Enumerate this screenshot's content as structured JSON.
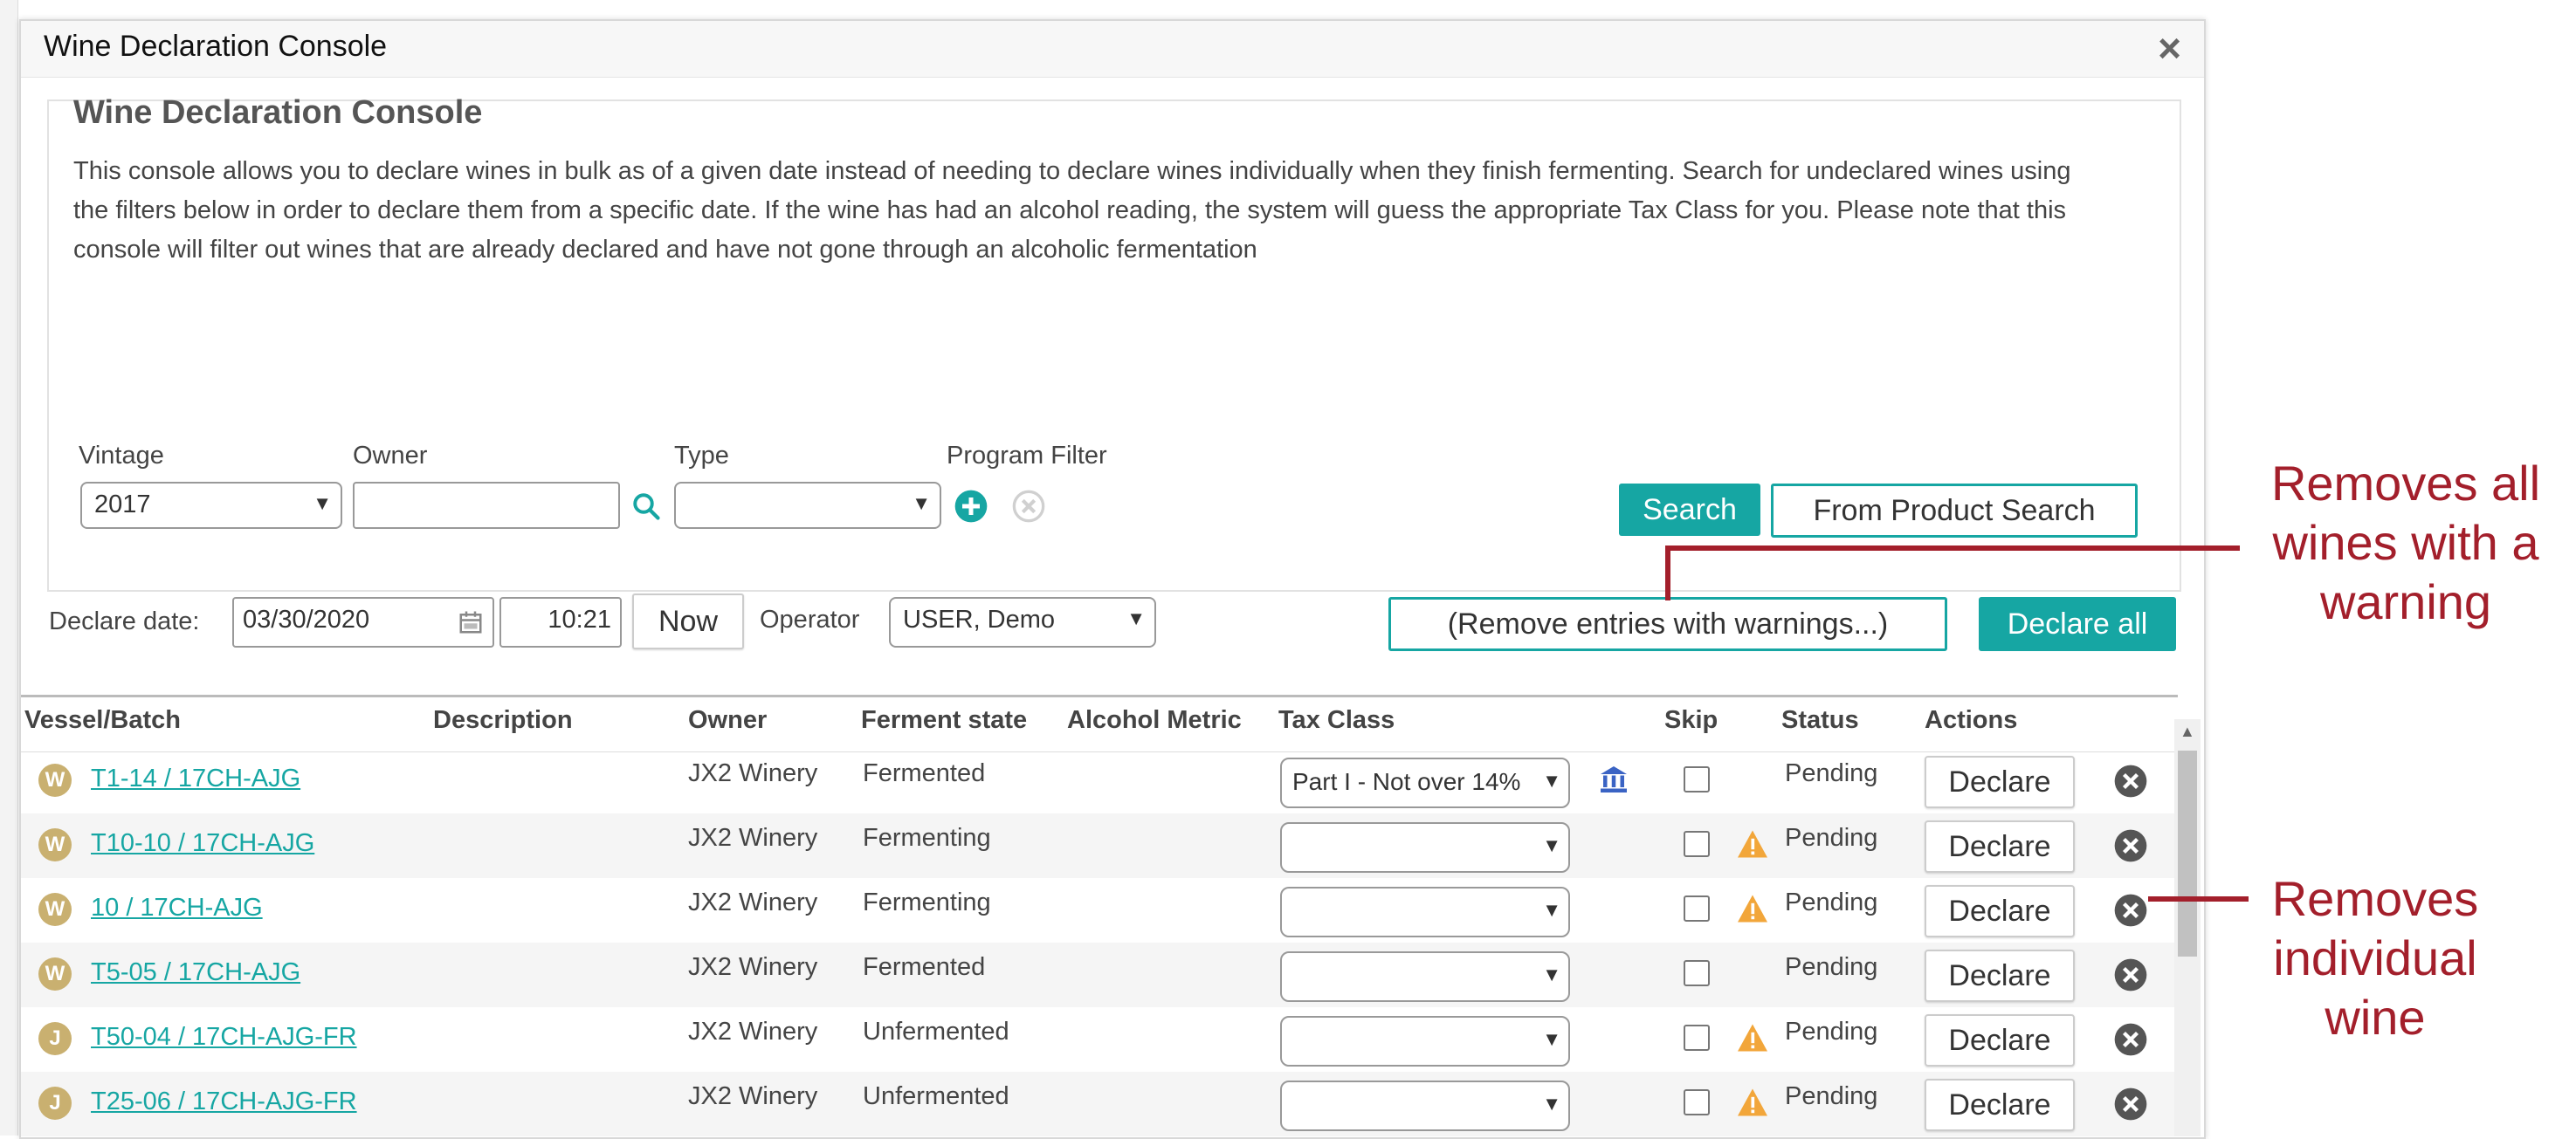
{
  "modal": {
    "title": "Wine Declaration Console",
    "close_glyph": "×"
  },
  "panel": {
    "title": "Wine Declaration Console",
    "description": "This console allows you to declare wines in bulk as of a given date instead of needing to declare wines individually when they finish fermenting. Search for undeclared wines using the filters below in order to declare them from a specific date. If the wine has had an alcohol reading, the system will guess the appropriate Tax Class for you. Please note that this console will filter out wines that are already declared and have not gone through an alcoholic fermentation"
  },
  "filters": {
    "vintage_label": "Vintage",
    "vintage_value": "2017",
    "owner_label": "Owner",
    "owner_value": "",
    "type_label": "Type",
    "type_value": "",
    "program_label": "Program Filter"
  },
  "buttons": {
    "search": "Search",
    "from_product_search": "From Product Search",
    "now": "Now",
    "remove_warnings": "(Remove entries with warnings...)",
    "declare_all": "Declare all"
  },
  "declare": {
    "date_label": "Declare date:",
    "date_value": "03/30/2020",
    "time_value": "10:21",
    "operator_label": "Operator",
    "operator_value": "USER, Demo"
  },
  "table": {
    "headers": {
      "vessel": "Vessel/Batch",
      "description": "Description",
      "owner": "Owner",
      "ferment": "Ferment state",
      "alcohol": "Alcohol Metric",
      "tax": "Tax Class",
      "skip": "Skip",
      "status": "Status",
      "actions": "Actions"
    },
    "declare_label": "Declare",
    "rows": [
      {
        "badge": "W",
        "vessel": "T1-14 / 17CH-AJG",
        "owner": "JX2 Winery",
        "ferment": "Fermented",
        "tax": "Part I - Not over 14%",
        "status": "Pending",
        "warning": false,
        "bank": true
      },
      {
        "badge": "W",
        "vessel": "T10-10 / 17CH-AJG",
        "owner": "JX2 Winery",
        "ferment": "Fermenting",
        "tax": "",
        "status": "Pending",
        "warning": true,
        "bank": false
      },
      {
        "badge": "W",
        "vessel": "10 / 17CH-AJG",
        "owner": "JX2 Winery",
        "ferment": "Fermenting",
        "tax": "",
        "status": "Pending",
        "warning": true,
        "bank": false
      },
      {
        "badge": "W",
        "vessel": "T5-05 / 17CH-AJG",
        "owner": "JX2 Winery",
        "ferment": "Fermented",
        "tax": "",
        "status": "Pending",
        "warning": false,
        "bank": false
      },
      {
        "badge": "J",
        "vessel": "T50-04 / 17CH-AJG-FR",
        "owner": "JX2 Winery",
        "ferment": "Unfermented",
        "tax": "",
        "status": "Pending",
        "warning": true,
        "bank": false
      },
      {
        "badge": "J",
        "vessel": "T25-06 / 17CH-AJG-FR",
        "owner": "JX2 Winery",
        "ferment": "Unfermented",
        "tax": "",
        "status": "Pending",
        "warning": true,
        "bank": false
      }
    ]
  },
  "annotations": {
    "remove_all": "Removes all wines with a warning",
    "remove_one": "Removes individual wine"
  },
  "colors": {
    "accent": "#16a6a3",
    "badge": "#c9b070",
    "warning": "#f2a63a",
    "annotation": "#a31f2b"
  }
}
